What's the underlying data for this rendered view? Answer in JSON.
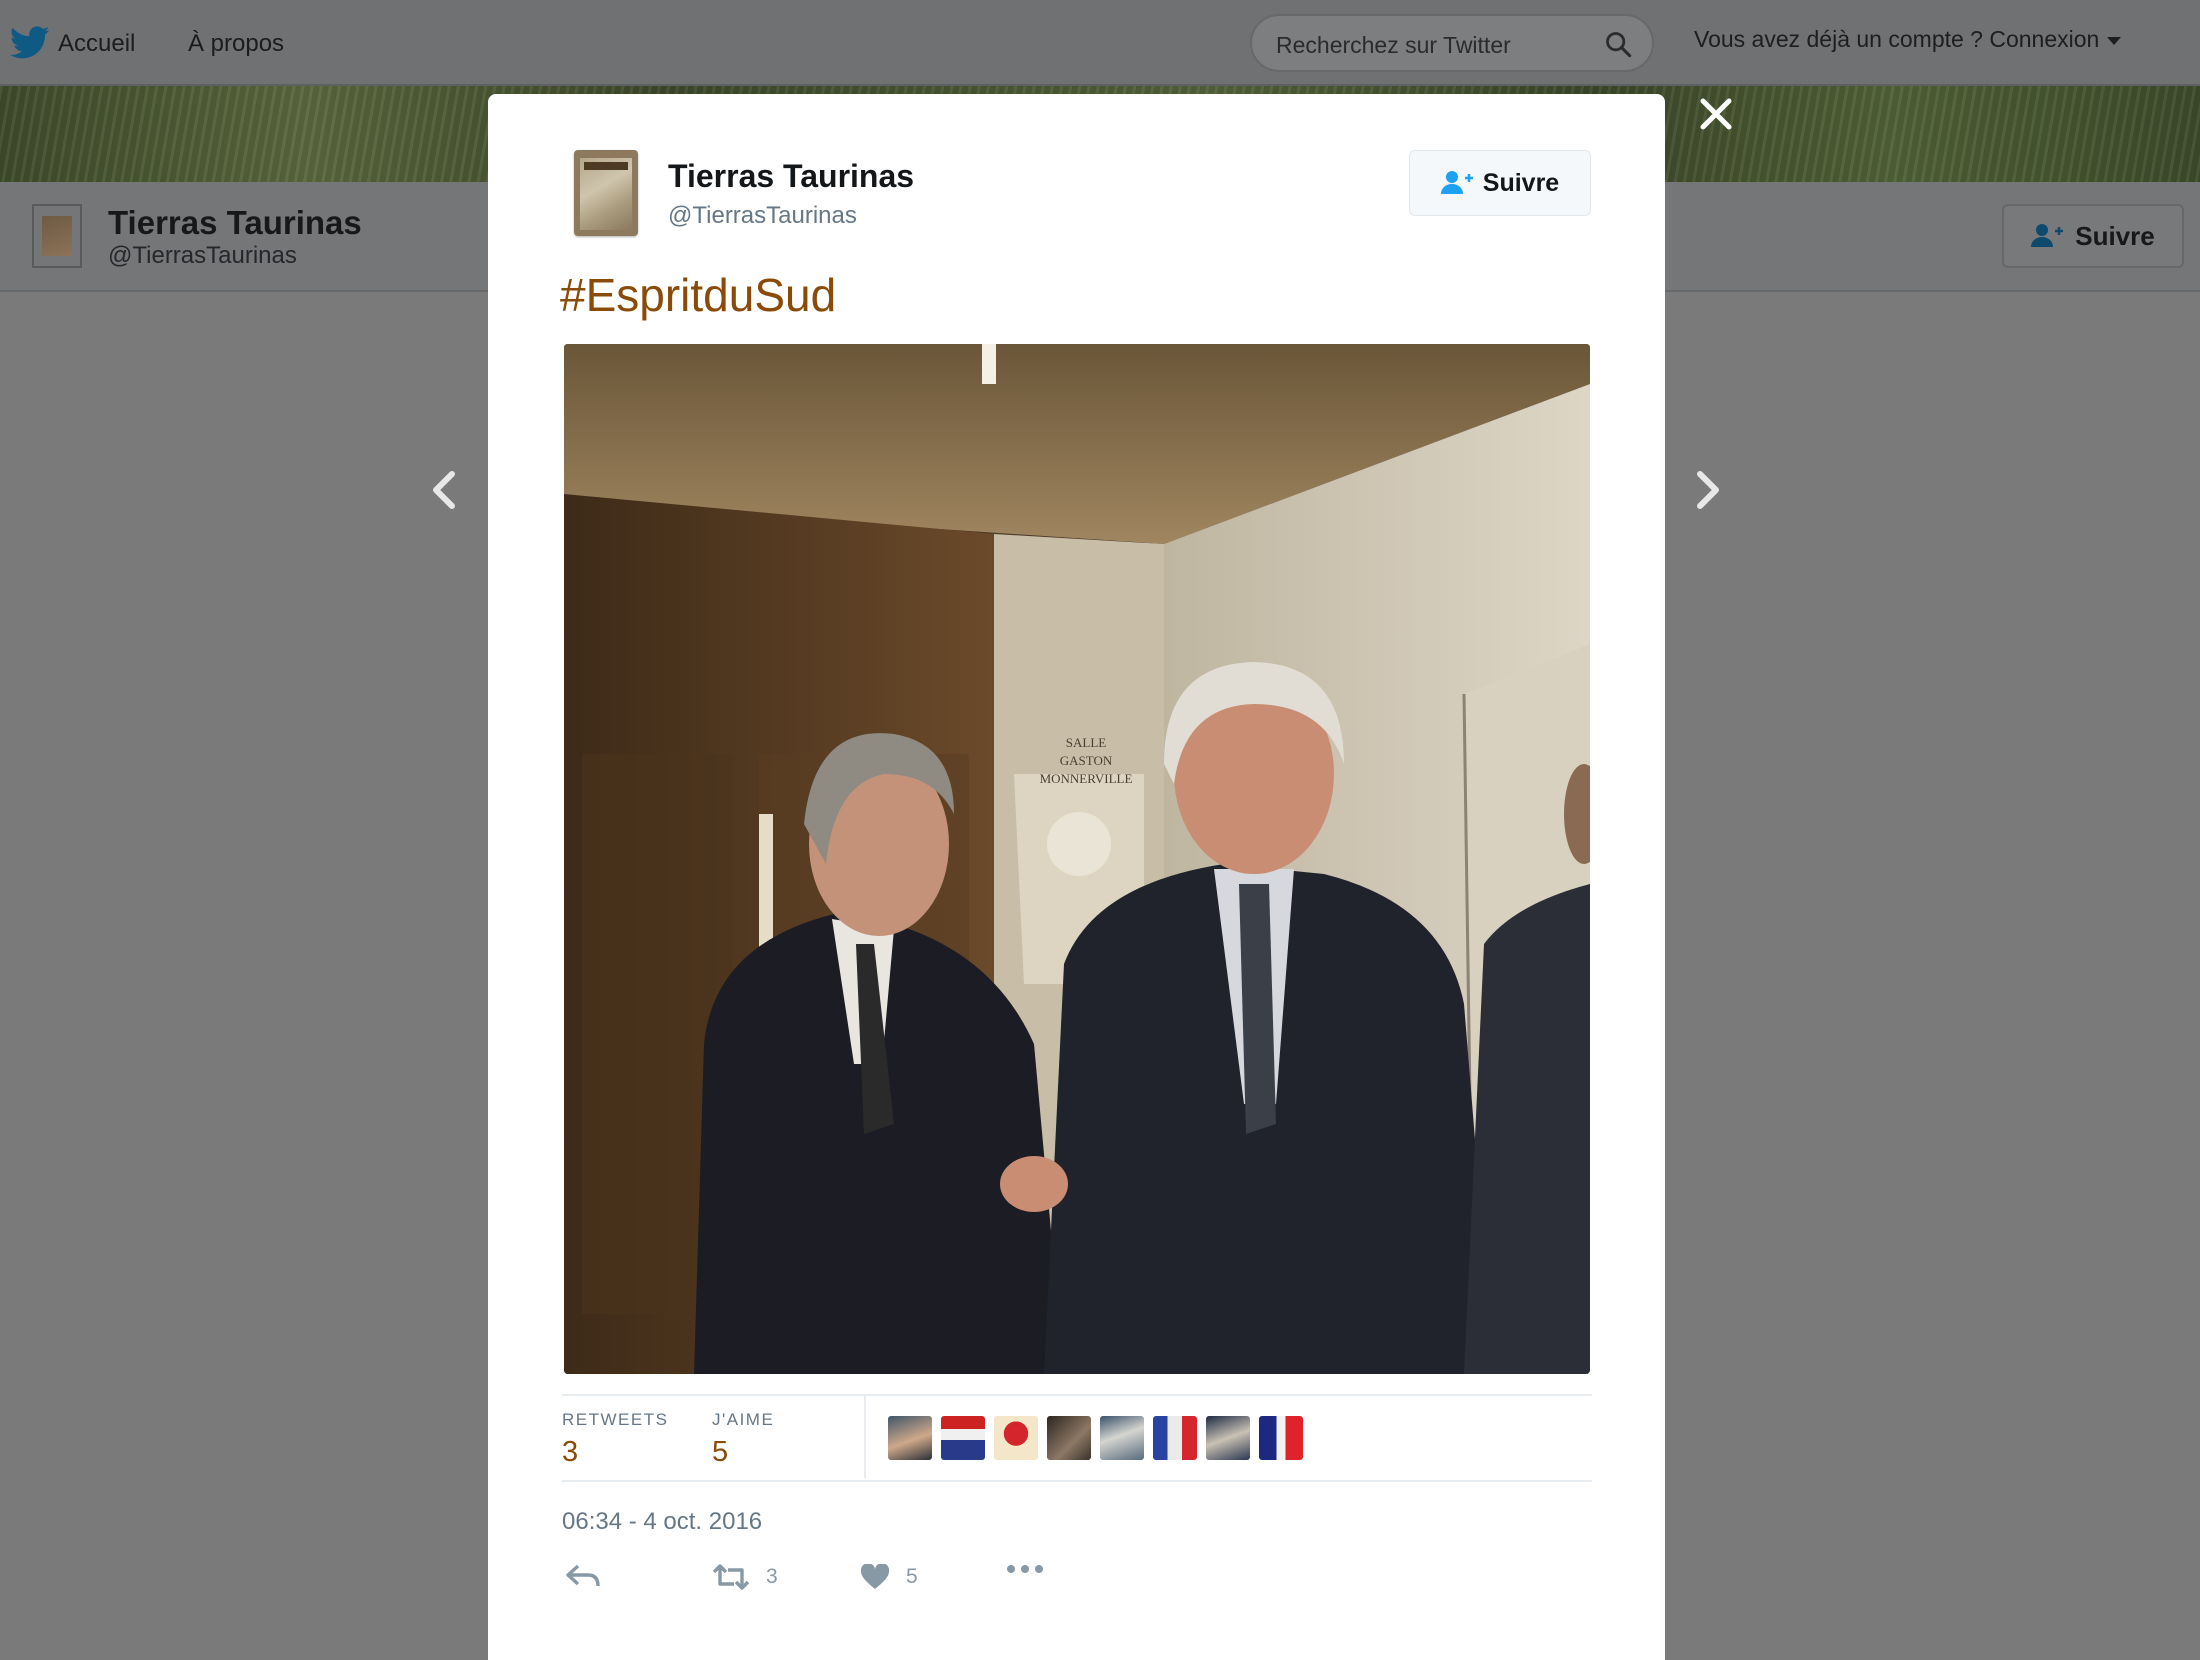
{
  "topbar": {
    "home_label": "Accueil",
    "about_label": "À propos",
    "search_placeholder": "Recherchez sur Twitter",
    "login_label": "Vous avez déjà un compte ? Connexion"
  },
  "profile": {
    "name": "Tierras Taurinas",
    "handle": "@TierrasTaurinas",
    "follow_label": "Suivre"
  },
  "tweet": {
    "author_name": "Tierras Taurinas",
    "author_handle": "@TierrasTaurinas",
    "follow_label": "Suivre",
    "text": "#EspritduSud",
    "photo_caption_lines": [
      "SALLE",
      "GASTON",
      "MONNERVILLE"
    ],
    "retweets_label": "RETWEETS",
    "retweets_count": "3",
    "likes_label": "J'AIME",
    "likes_count": "5",
    "timestamp": "06:34 - 4 oct. 2016",
    "action_retweet_count": "3",
    "action_like_count": "5"
  },
  "colors": {
    "link": "#8a4b08",
    "twitter_blue": "#1da1f2",
    "muted": "#657786",
    "overlay": "#7a7a7a"
  },
  "icons": [
    "twitter-bird-icon",
    "search-icon",
    "caret-down-icon",
    "follow-user-icon",
    "close-icon",
    "chevron-left-icon",
    "chevron-right-icon",
    "reply-icon",
    "retweet-icon",
    "heart-icon",
    "more-icon"
  ]
}
